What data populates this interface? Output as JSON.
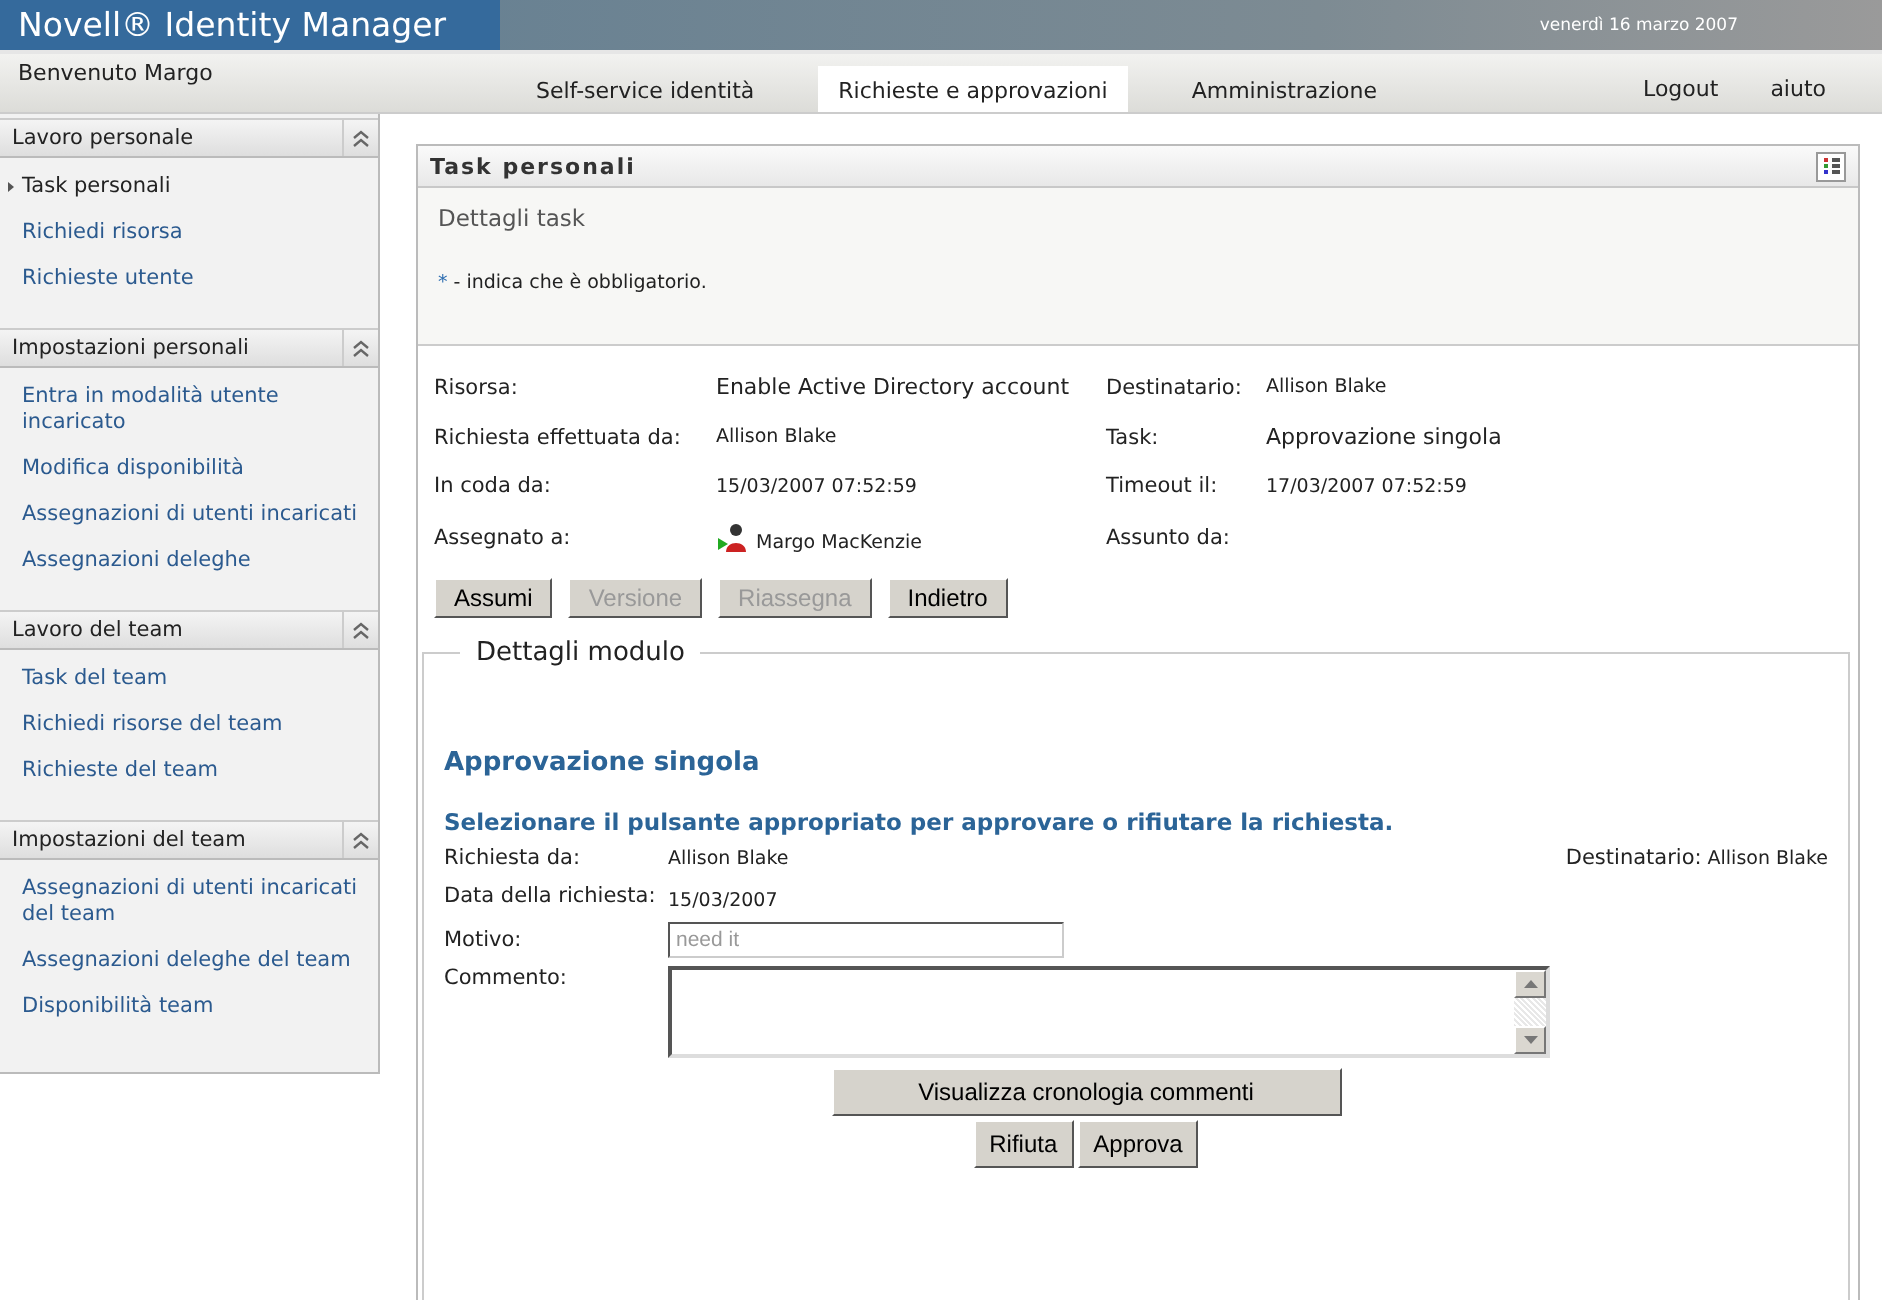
{
  "header": {
    "title": "Novell® Identity Manager",
    "date": "venerdì 16 marzo 2007"
  },
  "nav": {
    "welcome": "Benvenuto Margo",
    "tabs": [
      {
        "label": "Self-service identità",
        "selected": false
      },
      {
        "label": "Richieste e approvazioni",
        "selected": true
      },
      {
        "label": "Amministrazione",
        "selected": false
      }
    ],
    "links": [
      "Logout",
      "aiuto"
    ]
  },
  "sidebar": {
    "sections": [
      {
        "title": "Lavoro personale",
        "expanded": true,
        "items": [
          {
            "label": "Task personali",
            "selected": true
          },
          {
            "label": "Richiedi risorsa",
            "selected": false
          },
          {
            "label": "Richieste utente",
            "selected": false
          }
        ]
      },
      {
        "title": "Impostazioni personali",
        "expanded": true,
        "items": [
          {
            "label": "Entra in modalità utente incaricato",
            "selected": false
          },
          {
            "label": "Modifica disponibilità",
            "selected": false
          },
          {
            "label": "Assegnazioni di utenti incaricati",
            "selected": false
          },
          {
            "label": "Assegnazioni deleghe",
            "selected": false
          }
        ]
      },
      {
        "title": "Lavoro del team",
        "expanded": true,
        "items": [
          {
            "label": "Task del team",
            "selected": false
          },
          {
            "label": "Richiedi risorse del team",
            "selected": false
          },
          {
            "label": "Richieste del team",
            "selected": false
          }
        ]
      },
      {
        "title": "Impostazioni del team",
        "expanded": true,
        "items": [
          {
            "label": "Assegnazioni di utenti incaricati del team",
            "selected": false
          },
          {
            "label": "Assegnazioni deleghe del team",
            "selected": false
          },
          {
            "label": "Disponibilità team",
            "selected": false
          }
        ]
      }
    ]
  },
  "panel": {
    "title": "Task personali",
    "subtitle": "Dettagli task",
    "required_mark": "*",
    "required_note": "- indica che è obbligatorio.",
    "details": [
      {
        "label": "Risorsa:",
        "value": "Enable Active Directory account",
        "kind": "large"
      },
      {
        "label": "Destinatario:",
        "value": "Allison Blake",
        "kind": "small"
      },
      {
        "label": "Richiesta effettuata da:",
        "value": "Allison Blake",
        "kind": "small"
      },
      {
        "label": "Task:",
        "value": "Approvazione singola",
        "kind": "large"
      },
      {
        "label": "In coda da:",
        "value": "15/03/2007 07:52:59",
        "kind": "small"
      },
      {
        "label": "Timeout il:",
        "value": "17/03/2007 07:52:59",
        "kind": "small"
      },
      {
        "label": "Assegnato a:",
        "value": "Margo MacKenzie",
        "kind": "user"
      },
      {
        "label": "Assunto da:",
        "kind": "empty"
      }
    ],
    "buttons": [
      {
        "label": "Assumi",
        "disabled": false
      },
      {
        "label": "Versione",
        "disabled": true
      },
      {
        "label": "Riassegna",
        "disabled": true
      },
      {
        "label": "Indietro",
        "disabled": false
      }
    ]
  },
  "form": {
    "legend": "Dettagli modulo",
    "title": "Approvazione singola",
    "instruction": "Selezionare il pulsante appropriato per approvare o rifiutare la richiesta.",
    "requested_by": {
      "label": "Richiesta da:",
      "value": "Allison Blake"
    },
    "recipient": {
      "label": "Destinatario:",
      "value": "Allison Blake"
    },
    "request_date": {
      "label": "Data della richiesta:",
      "value": "15/03/2007"
    },
    "reason": {
      "label": "Motivo:",
      "placeholder": "need it"
    },
    "comment": {
      "label": "Commento:"
    },
    "history_button": "Visualizza cronologia commenti",
    "actions": [
      "Rifiuta",
      "Approva"
    ]
  }
}
